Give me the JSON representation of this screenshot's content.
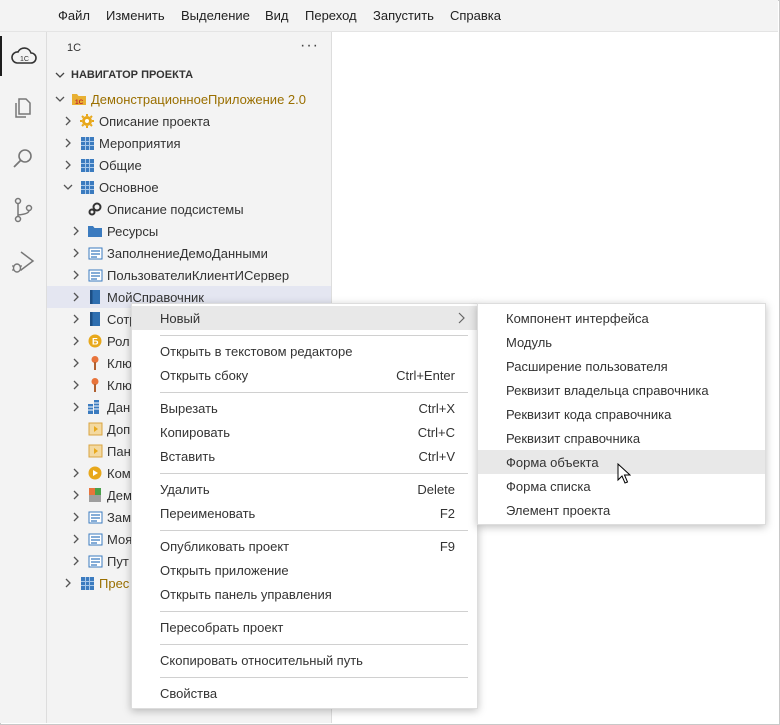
{
  "menubar": {
    "items": [
      "Файл",
      "Изменить",
      "Выделение",
      "Вид",
      "Переход",
      "Запустить",
      "Справка"
    ]
  },
  "activity_bar": [
    "cloud-1c-icon",
    "files-icon",
    "search-icon",
    "source-control-icon",
    "run-debug-icon"
  ],
  "sidebar": {
    "title": "1С",
    "more": "···",
    "section_title": "НАВИГАТОР ПРОЕКТА",
    "project": "ДемонстрационноеПриложение 2.0",
    "tree": [
      {
        "label": "Описание проекта",
        "icon": "gear-icon"
      },
      {
        "label": "Мероприятия",
        "icon": "subsystem-icon"
      },
      {
        "label": "Общие",
        "icon": "subsystem-icon"
      },
      {
        "label": "Основное",
        "icon": "subsystem-icon"
      },
      {
        "label": "Описание подсистемы",
        "icon": "gears-icon"
      },
      {
        "label": "Ресурсы",
        "icon": "folder-icon"
      },
      {
        "label": "ЗаполнениеДемоДанными",
        "icon": "module-icon"
      },
      {
        "label": "ПользователиКлиентИСервер",
        "icon": "module-icon"
      },
      {
        "label": "МойСправочник",
        "icon": "catalog-icon"
      },
      {
        "label": "Сотр",
        "icon": "catalog-icon"
      },
      {
        "label": "Рол",
        "icon": "role-icon"
      },
      {
        "label": "Клю",
        "icon": "key-icon"
      },
      {
        "label": "Клю",
        "icon": "key-icon"
      },
      {
        "label": "Дан",
        "icon": "data-icon"
      },
      {
        "label": "Доп",
        "icon": "form-icon"
      },
      {
        "label": "Пан",
        "icon": "form-icon"
      },
      {
        "label": "Ком",
        "icon": "component-icon"
      },
      {
        "label": "Дем",
        "icon": "chart-icon"
      },
      {
        "label": "Зам",
        "icon": "module-icon"
      },
      {
        "label": "Моя",
        "icon": "module-icon"
      },
      {
        "label": "Пут",
        "icon": "module-icon"
      },
      {
        "label": "Прес",
        "icon": "subsystem-icon"
      }
    ]
  },
  "context_menu": {
    "items": [
      {
        "label": "Новый",
        "shortcut": ""
      },
      {
        "label": "Открыть в текстовом редакторе",
        "shortcut": ""
      },
      {
        "label": "Открыть сбоку",
        "shortcut": "Ctrl+Enter"
      },
      {
        "label": "Вырезать",
        "shortcut": "Ctrl+X"
      },
      {
        "label": "Копировать",
        "shortcut": "Ctrl+C"
      },
      {
        "label": "Вставить",
        "shortcut": "Ctrl+V"
      },
      {
        "label": "Удалить",
        "shortcut": "Delete"
      },
      {
        "label": "Переименовать",
        "shortcut": "F2"
      },
      {
        "label": "Опубликовать проект",
        "shortcut": "F9"
      },
      {
        "label": "Открыть приложение",
        "shortcut": ""
      },
      {
        "label": "Открыть панель управления",
        "shortcut": ""
      },
      {
        "label": "Пересобрать проект",
        "shortcut": ""
      },
      {
        "label": "Скопировать относительный путь",
        "shortcut": ""
      },
      {
        "label": "Свойства",
        "shortcut": ""
      }
    ]
  },
  "submenu": {
    "items": [
      "Компонент интерфейса",
      "Модуль",
      "Расширение пользователя",
      "Реквизит владельца справочника",
      "Реквизит кода справочника",
      "Реквизит справочника",
      "Форма объекта",
      "Форма списка",
      "Элемент проекта"
    ]
  }
}
